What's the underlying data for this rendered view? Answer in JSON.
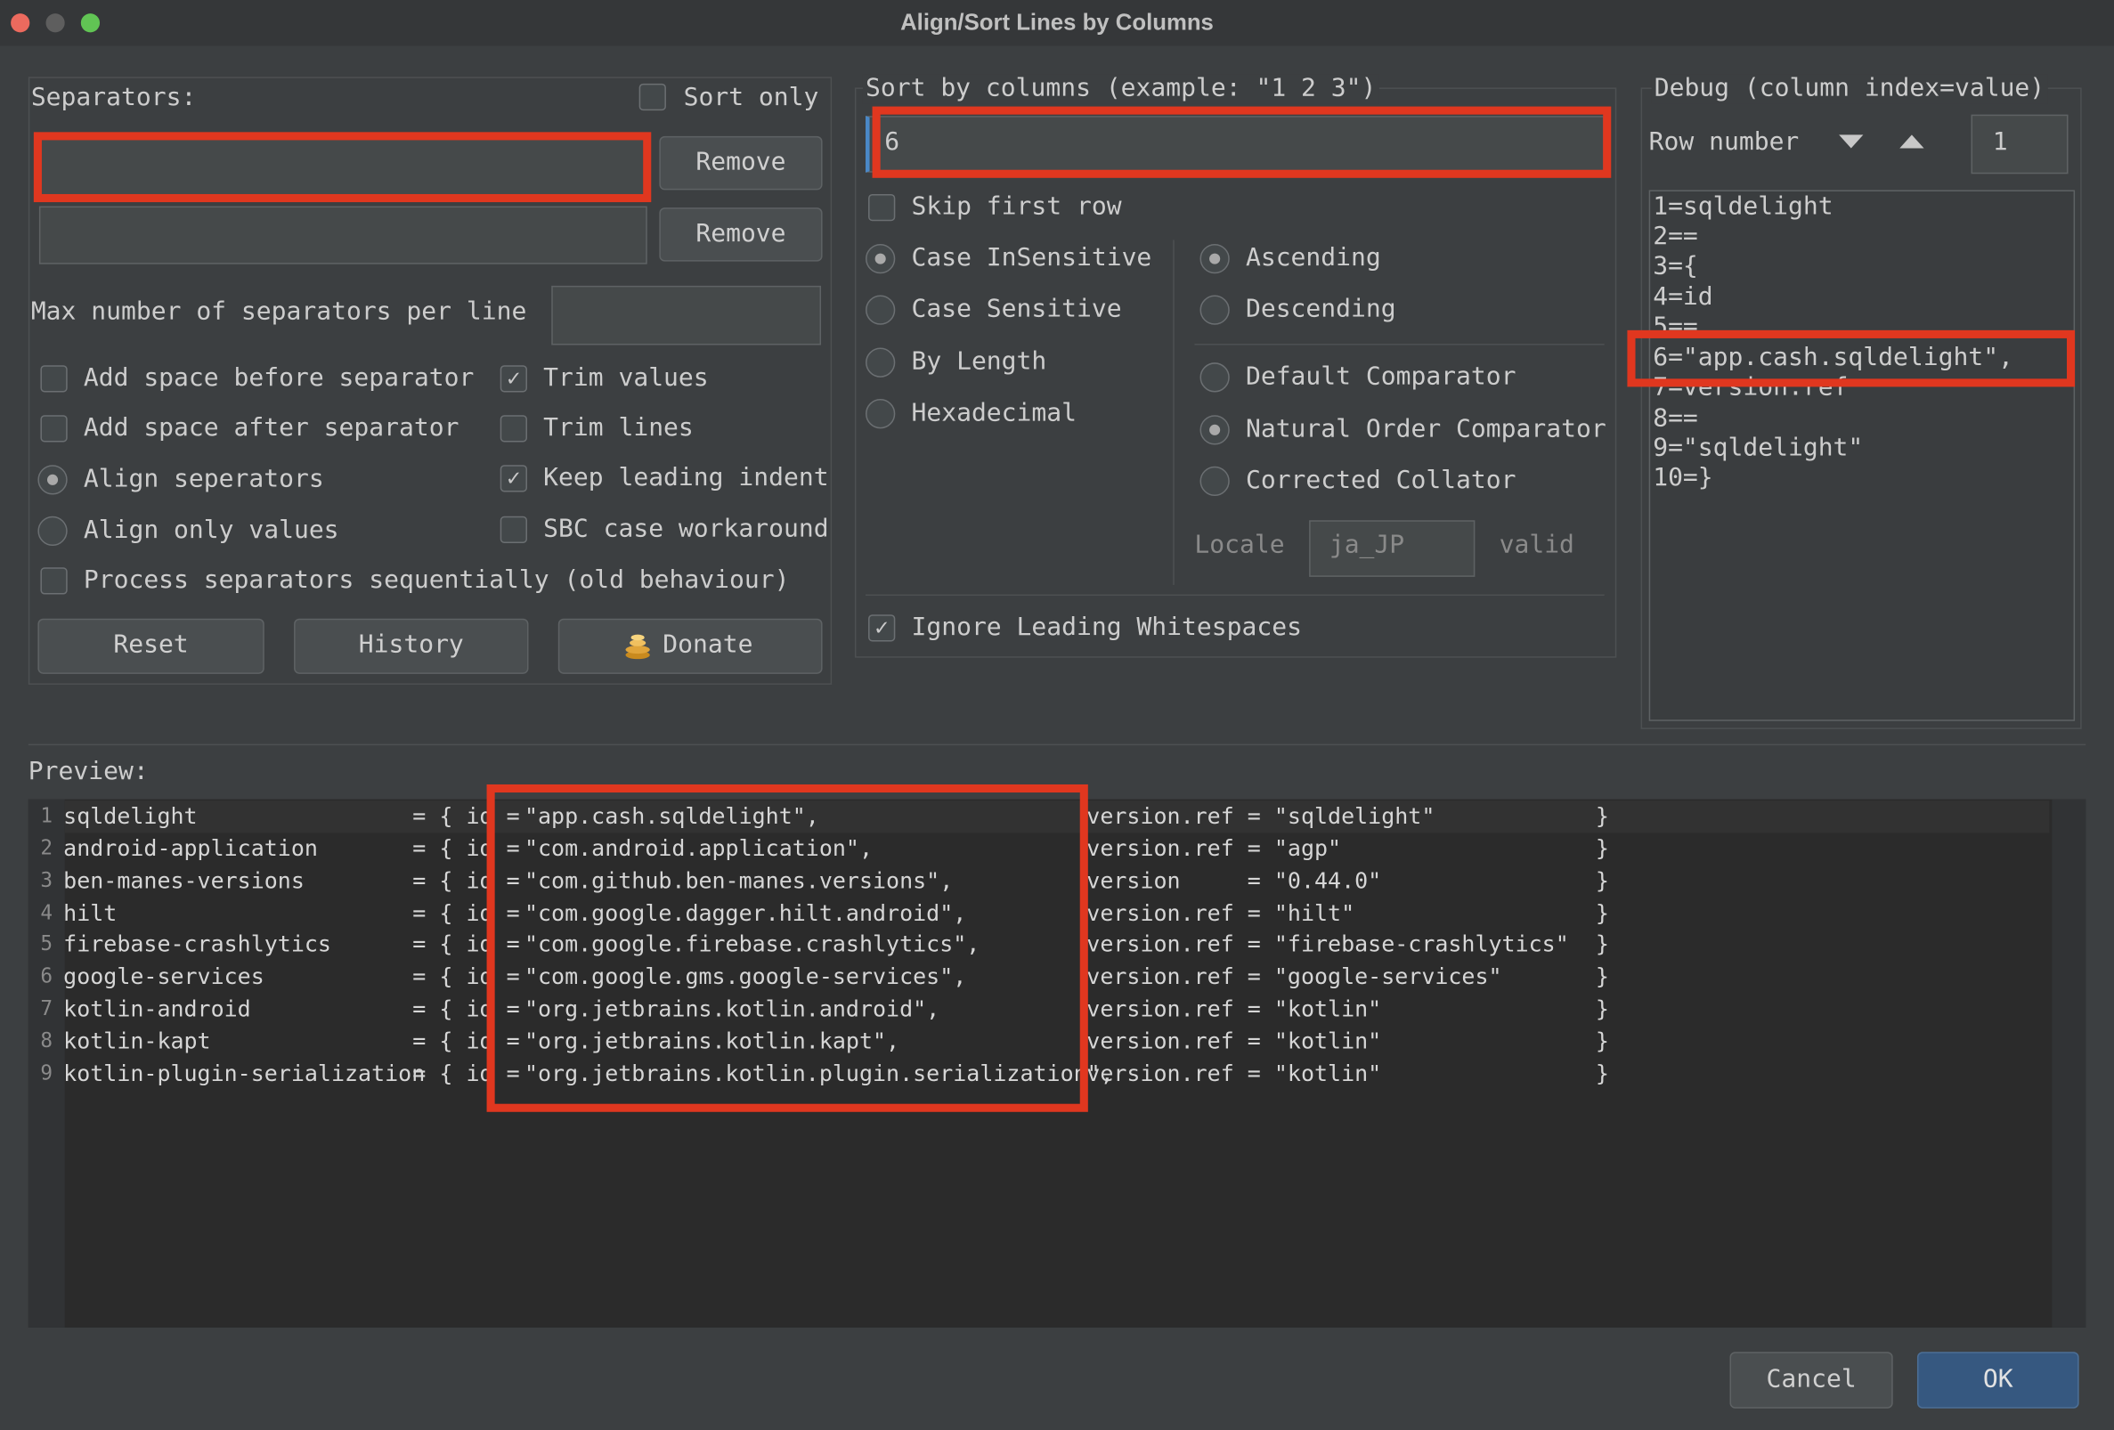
{
  "window": {
    "title": "Align/Sort Lines by Columns"
  },
  "separators": {
    "label": "Separators:",
    "sort_only": "Sort only",
    "remove_1": "Remove",
    "remove_2": "Remove",
    "max_label": "Max number of separators per line",
    "add_space_before": "Add space before separator",
    "trim_values": "Trim values",
    "add_space_after": "Add space after separator",
    "trim_lines": "Trim lines",
    "align_separators": "Align seperators",
    "keep_indent": "Keep leading indent",
    "align_values": "Align only values",
    "sbc": "SBC case workaround",
    "process_seq": "Process separators sequentially (old behaviour)",
    "reset": "Reset",
    "history": "History",
    "donate": "Donate"
  },
  "sort": {
    "label": "Sort by columns (example: \"1 2 3\")",
    "value": "6",
    "skip_first_row": "Skip first row",
    "case_insensitive": "Case InSensitive",
    "case_sensitive": "Case Sensitive",
    "by_length": "By Length",
    "hexadecimal": "Hexadecimal",
    "ascending": "Ascending",
    "descending": "Descending",
    "default_comparator": "Default Comparator",
    "natural_comparator": "Natural Order Comparator",
    "corrected_collator": "Corrected Collator",
    "locale_label": "Locale",
    "locale_value": "ja_JP",
    "locale_status": "valid",
    "ignore_ws": "Ignore Leading Whitespaces"
  },
  "debug": {
    "label": "Debug (column index=value)",
    "row_label": "Row number",
    "row_value": "1",
    "lines": [
      "1=sqldelight",
      "2==",
      "3={",
      "4=id",
      "5==",
      "6=\"app.cash.sqldelight\",",
      "7=version.ref",
      "8==",
      "9=\"sqldelight\"",
      "10=}"
    ]
  },
  "preview": {
    "label": "Preview:",
    "rows": [
      {
        "n": "1",
        "name": "sqldelight                  ",
        "mid": "= { id = ",
        "val": "\"app.cash.sqldelight\",                     ",
        "ver": "version.ref = \"sqldelight\"            }"
      },
      {
        "n": "2",
        "name": "android-application         ",
        "mid": "= { id = ",
        "val": "\"com.android.application\",                 ",
        "ver": "version.ref = \"agp\"                   }"
      },
      {
        "n": "3",
        "name": "ben-manes-versions          ",
        "mid": "= { id = ",
        "val": "\"com.github.ben-manes.versions\",           ",
        "ver": "version     = \"0.44.0\"                }"
      },
      {
        "n": "4",
        "name": "hilt                        ",
        "mid": "= { id = ",
        "val": "\"com.google.dagger.hilt.android\",          ",
        "ver": "version.ref = \"hilt\"                  }"
      },
      {
        "n": "5",
        "name": "firebase-crashlytics        ",
        "mid": "= { id = ",
        "val": "\"com.google.firebase.crashlytics\",         ",
        "ver": "version.ref = \"firebase-crashlytics\"  }"
      },
      {
        "n": "6",
        "name": "google-services             ",
        "mid": "= { id = ",
        "val": "\"com.google.gms.google-services\",          ",
        "ver": "version.ref = \"google-services\"       }"
      },
      {
        "n": "7",
        "name": "kotlin-android              ",
        "mid": "= { id = ",
        "val": "\"org.jetbrains.kotlin.android\",            ",
        "ver": "version.ref = \"kotlin\"                }"
      },
      {
        "n": "8",
        "name": "kotlin-kapt                 ",
        "mid": "= { id = ",
        "val": "\"org.jetbrains.kotlin.kapt\",               ",
        "ver": "version.ref = \"kotlin\"                }"
      },
      {
        "n": "9",
        "name": "kotlin-plugin-serialization ",
        "mid": "= { id = ",
        "val": "\"org.jetbrains.kotlin.plugin.serialization\",",
        "ver": "version.ref = \"kotlin\"                }"
      }
    ]
  },
  "footer": {
    "cancel": "Cancel",
    "ok": "OK"
  },
  "colors": {
    "highlight": "#e0371f",
    "ok_button": "#365880"
  }
}
